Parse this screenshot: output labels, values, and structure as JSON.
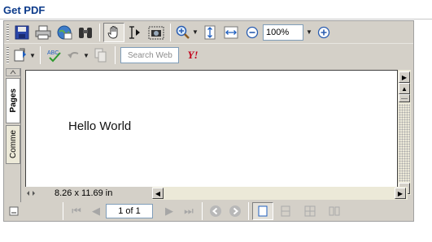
{
  "header": {
    "title": "Get PDF"
  },
  "toolbar": {
    "zoom_value": "100%",
    "search_placeholder": "Search Web",
    "yahoo_label": "Y!",
    "spell_label": "ABC"
  },
  "side_tabs": [
    {
      "label": "Pages"
    },
    {
      "label": "Comme"
    }
  ],
  "document": {
    "text": "Hello World"
  },
  "status": {
    "page_size": "8.26 x 11.69 in"
  },
  "navigation": {
    "page_value": "1 of 1"
  },
  "colors": {
    "accent": "#0b3a8a",
    "toolbar": "#d4d0c8"
  }
}
